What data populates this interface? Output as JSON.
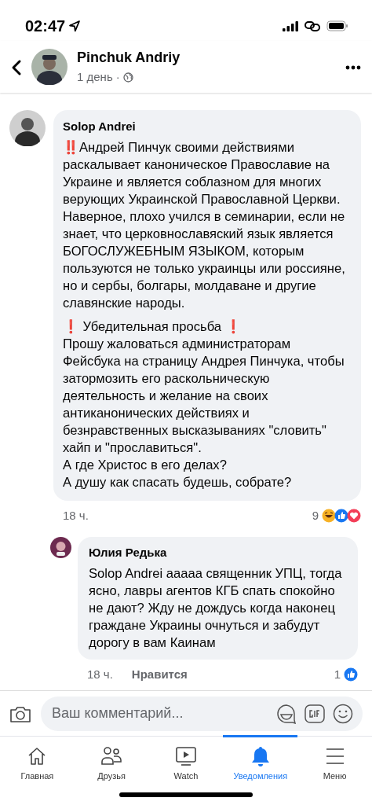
{
  "status_bar": {
    "time": "02:47"
  },
  "header": {
    "author": "Pinchuk Andriy",
    "meta": "1 день ·"
  },
  "comments": [
    {
      "author": "Solop Andrei",
      "paragraphs": [
        "‼️Андрей Пинчук своими действиями раскалывает каноническое Православие на Украине и является соблазном для многих верующих Украинской Православной Церкви. Наверное, плохо учился в семинарии, если не знает, что церковнославяский язык является БОГОСЛУЖЕБНЫМ ЯЗЫКОМ, которым пользуются не только украинцы или россияне, но и сербы, болгары, молдаване и другие славянские народы.",
        "❗ Убедительная просьба ❗\nПрошу жаловаться администраторам Фейсбука на страницу Андрея Пинчука, чтобы затормозить его раскольническую деятельность и желание на своих антиканонических действиях и безнравственных высказываниях \"словить\" хайп и \"прославиться\".\nА где Христос в его делах?\nА душу как спасать будешь, собрате?"
      ],
      "time": "18 ч.",
      "reaction_count": "9",
      "reactions": [
        {
          "kind": "haha"
        },
        {
          "kind": "like"
        },
        {
          "kind": "love"
        }
      ],
      "reply": false
    },
    {
      "author": "Юлия Редька",
      "paragraphs": [
        "Solop Andrei ааааа священник УПЦ, тогда ясно, лавры агентов КГБ спать спокойно не дают? Жду не дождусь когда наконец граждане Украины очнуться и забудут дорогу в вам Каинам"
      ],
      "time": "18 ч.",
      "like_label": "Нравится",
      "reaction_count": "1",
      "reactions": [
        {
          "kind": "like"
        }
      ],
      "reply": true
    }
  ],
  "composer": {
    "placeholder": "Ваш комментарий..."
  },
  "tabs": [
    {
      "kind": "home",
      "label": "Главная",
      "selected": false
    },
    {
      "kind": "friends",
      "label": "Друзья",
      "selected": false
    },
    {
      "kind": "watch",
      "label": "Watch",
      "selected": false
    },
    {
      "kind": "bell",
      "label": "Уведомления",
      "selected": true
    },
    {
      "kind": "menu",
      "label": "Меню",
      "selected": false
    }
  ]
}
